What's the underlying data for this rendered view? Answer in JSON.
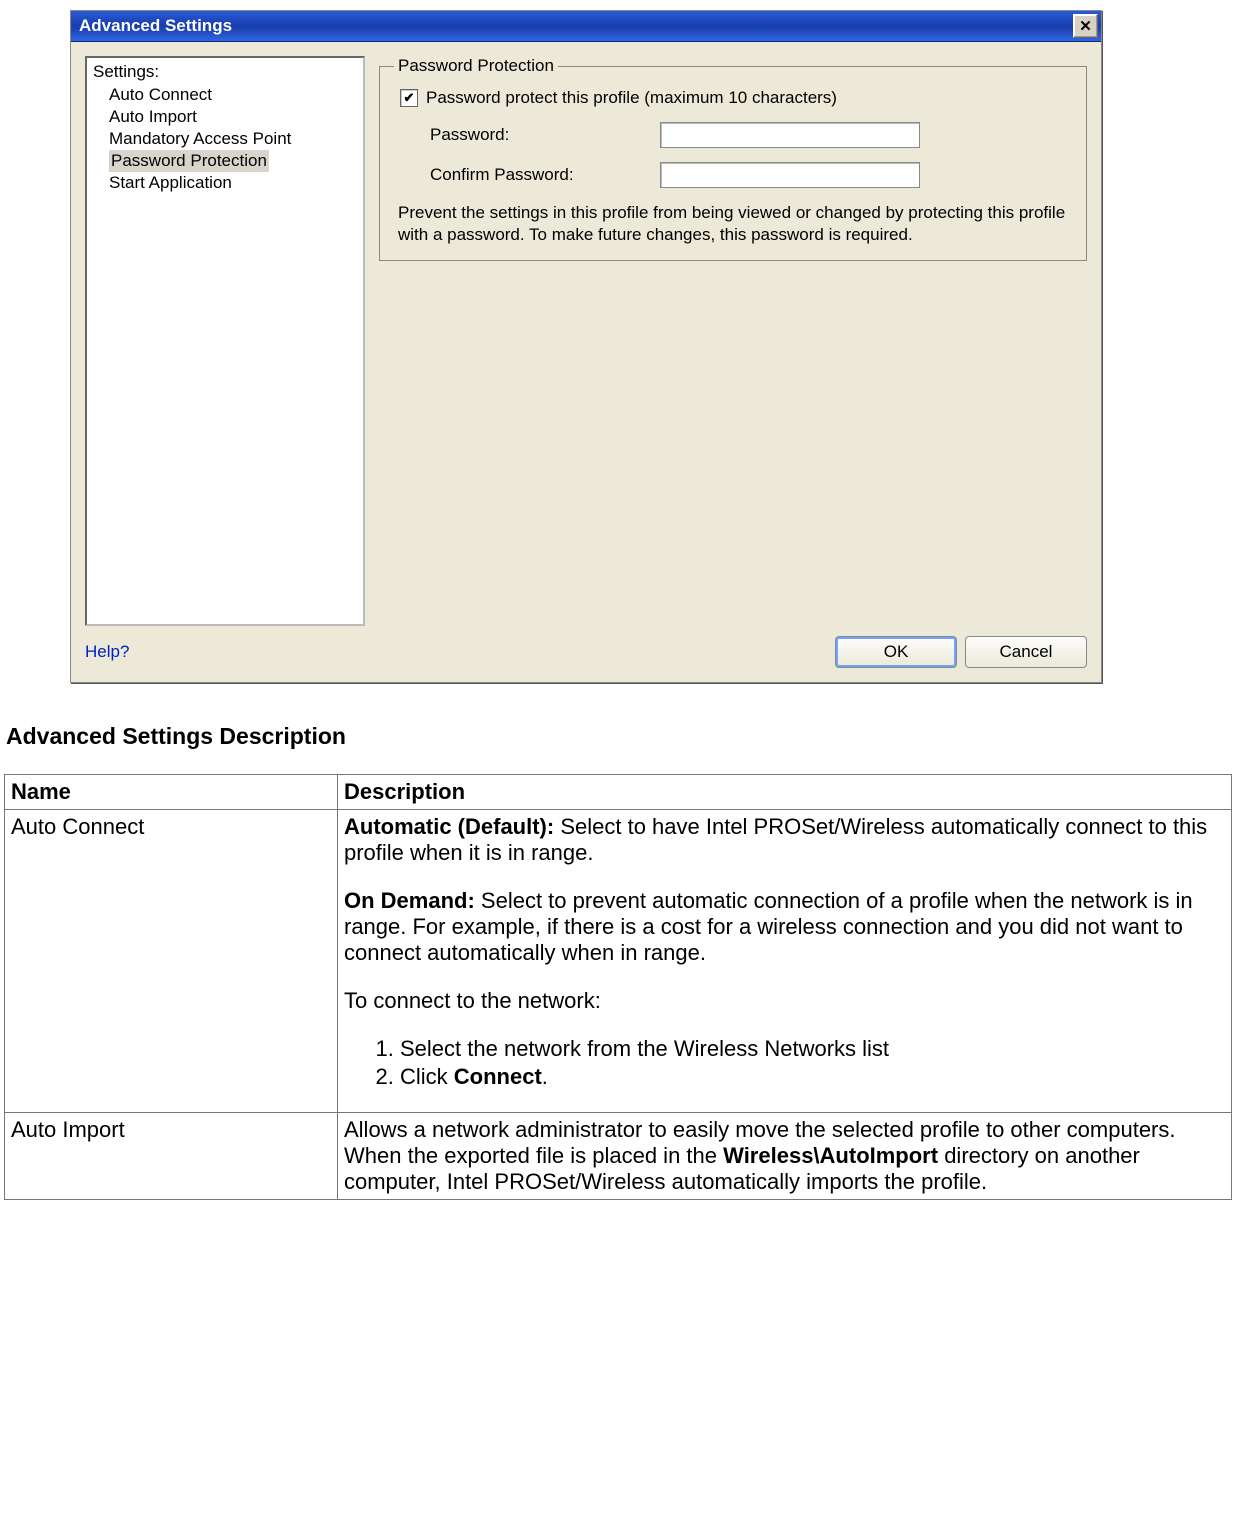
{
  "dialog": {
    "title": "Advanced Settings",
    "close_icon": "✕",
    "settings_header": "Settings:",
    "settings_items": [
      "Auto Connect",
      "Auto Import",
      "Mandatory Access Point",
      "Password Protection",
      "Start Application"
    ],
    "selected_index": 3,
    "fieldset_legend": "Password Protection",
    "checkbox_checked": true,
    "checkbox_label": "Password protect this profile (maximum 10 characters)",
    "password_label": "Password:",
    "confirm_label": "Confirm Password:",
    "description": "Prevent the settings in this profile from being viewed or changed by protecting this profile with a password. To make future changes, this password is required.",
    "help_label": "Help?",
    "ok_label": "OK",
    "cancel_label": "Cancel"
  },
  "doc": {
    "heading": "Advanced Settings Description",
    "th_name": "Name",
    "th_desc": "Description",
    "rows": [
      {
        "name": "Auto Connect",
        "auto_b": "Automatic (Default):",
        "auto_t": " Select to have Intel PROSet/Wireless automatically connect to this profile when it is in range.",
        "ond_b": "On Demand:",
        "ond_t": " Select to prevent automatic connection of a profile when the network is in range. For example, if there is a cost for a wireless connection and you did not want to connect automatically when in range.",
        "lead": "To connect to the network:",
        "step1": "Select the network from the Wireless Networks list",
        "step2a": "Click ",
        "step2b": "Connect",
        "step2c": "."
      },
      {
        "name": "Auto Import",
        "t1": "Allows a network administrator to easily move the selected profile to other computers. When the exported file is placed in the ",
        "b1": "Wireless\\AutoImport",
        "t2": " directory on another computer, Intel PROSet/Wireless automatically imports the profile."
      }
    ]
  }
}
